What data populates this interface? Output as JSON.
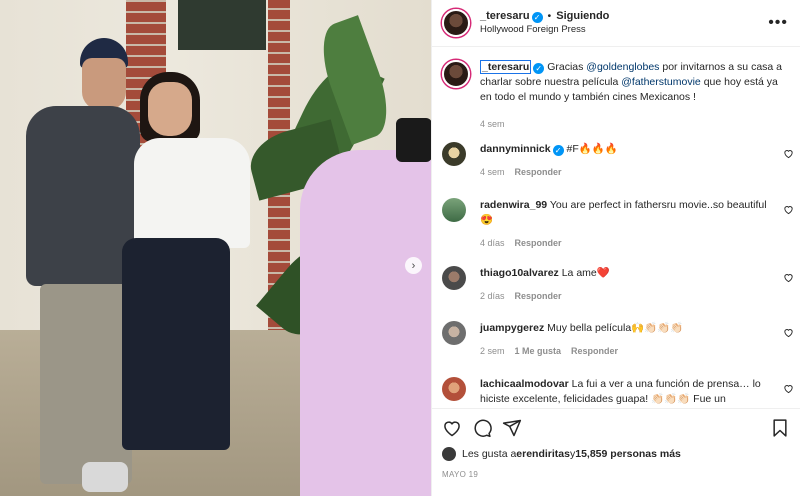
{
  "post": {
    "username": "_teresaru",
    "separator": "•",
    "follow_label": "Siguiendo",
    "location": "Hollywood Foreign Press",
    "more_label": "•••"
  },
  "caption": {
    "username": "_teresaru",
    "text_1": "Gracias ",
    "mention_1": "@goldenglobes",
    "text_2": " por invitarnos a su casa a charlar sobre nuestra película ",
    "mention_2": "@fatherstumovie",
    "text_3": " que hoy está ya en todo el mundo y también cines Mexicanos !",
    "time": "4 sem"
  },
  "comments": [
    {
      "username": "dannyminnick",
      "verified": true,
      "text": "#F🔥🔥🔥",
      "time": "4 sem",
      "likes": "",
      "reply": "Responder"
    },
    {
      "username": "radenwira_99",
      "verified": false,
      "text": "You are perfect in fathersru movie..so beautiful😍",
      "time": "4 días",
      "likes": "",
      "reply": "Responder"
    },
    {
      "username": "thiago10alvarez",
      "verified": false,
      "text": "La ame❤️",
      "time": "2 días",
      "likes": "",
      "reply": "Responder"
    },
    {
      "username": "juampygerez",
      "verified": false,
      "text": "Muy bella película🙌👏🏻👏🏻👏🏻",
      "time": "2 sem",
      "likes": "1 Me gusta",
      "reply": "Responder"
    },
    {
      "username": "lachicaalmodovar",
      "verified": false,
      "text": "La fui a ver a una función de prensa… lo hiciste excelente, felicidades guapa! 👏🏻👏🏻👏🏻 Fue un",
      "time": "",
      "likes": "",
      "reply": ""
    }
  ],
  "likes": {
    "prefix": "Les gusta a ",
    "user": "erendiritas",
    "middle": " y ",
    "count": "15,859 personas más"
  },
  "date": "MAYO 19",
  "carousel_next": "›",
  "icons": [
    "heart-icon",
    "comment-icon",
    "share-icon",
    "bookmark-icon",
    "verified-icon",
    "more-icon"
  ],
  "colors": {
    "verified": "#0095f6",
    "mention": "#00376b",
    "muted": "#8e8e8e",
    "ring": "#d62976"
  }
}
